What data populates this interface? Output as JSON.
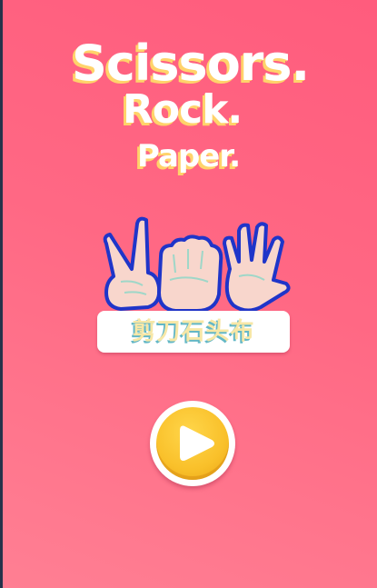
{
  "title": {
    "line1": "Scissors.",
    "line2": "Rock.",
    "line3": "Paper."
  },
  "logo": {
    "caption": "剪刀石头布",
    "icon": "hands-rock-paper-scissors-icon"
  },
  "play_button": {
    "icon": "play-icon"
  },
  "colors": {
    "background_top": "#ff5c7d",
    "background_bottom": "#ff7f93",
    "title_fill": "#ffffff",
    "title_shadow": "#ffd36a",
    "button_yellow": "#f9c02a",
    "hand_outline": "#1f35c9",
    "hand_fill": "#f8d6cc"
  }
}
